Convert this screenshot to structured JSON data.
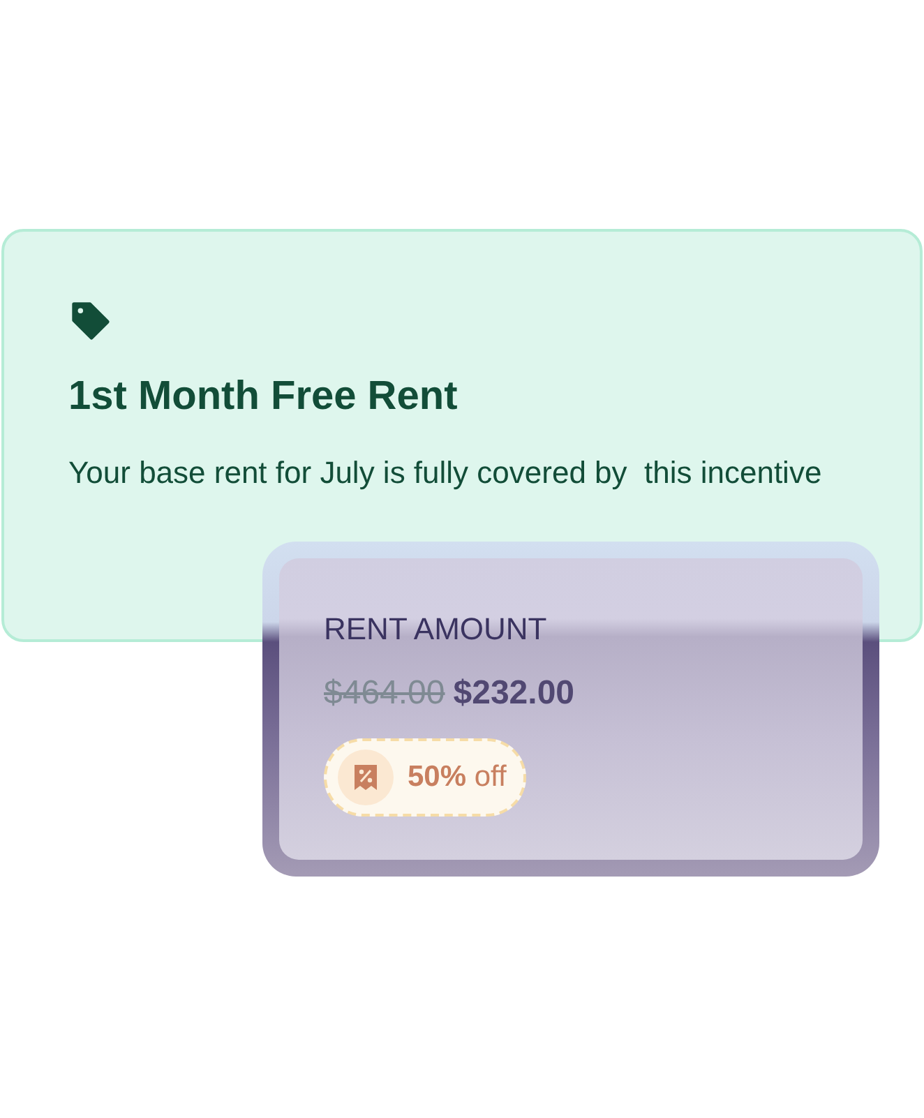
{
  "incentive": {
    "title": "1st Month Free Rent",
    "description": "Your base rent for July is fully covered by  this incentive"
  },
  "rent": {
    "label": "RENT AMOUNT",
    "original_price": "$464.00",
    "price": "$232.00",
    "discount": "**50%** off"
  }
}
